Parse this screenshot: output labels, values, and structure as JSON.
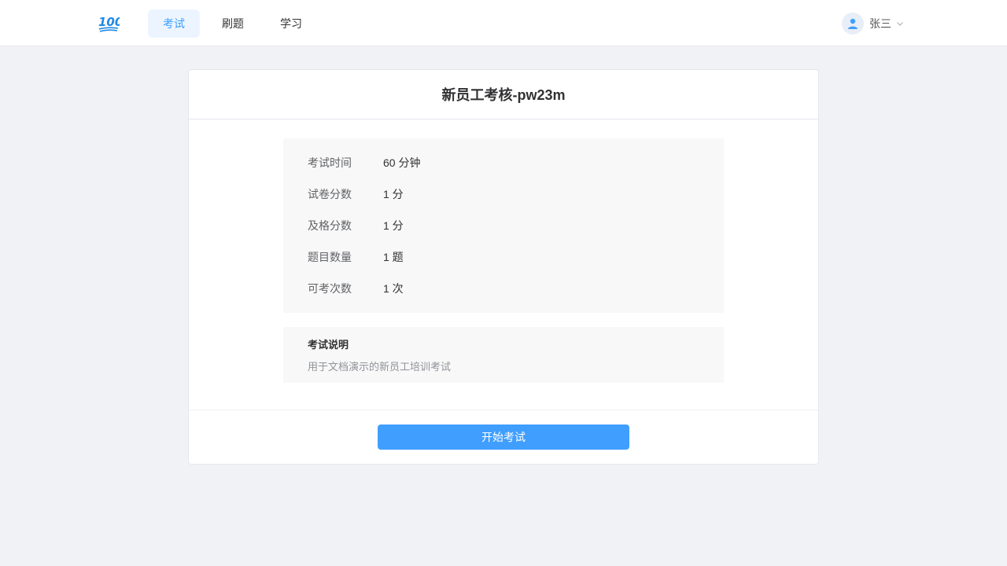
{
  "header": {
    "logo_icon": "hundred-points-logo",
    "nav": [
      {
        "label": "考试",
        "active": true
      },
      {
        "label": "刷题",
        "active": false
      },
      {
        "label": "学习",
        "active": false
      }
    ],
    "user": {
      "name": "张三",
      "avatar_icon": "user-icon",
      "dropdown_icon": "chevron-down-icon"
    }
  },
  "exam": {
    "title": "新员工考核-pw23m",
    "info": [
      {
        "label": "考试时间",
        "value": "60 分钟"
      },
      {
        "label": "试卷分数",
        "value": "1 分"
      },
      {
        "label": "及格分数",
        "value": "1 分"
      },
      {
        "label": "题目数量",
        "value": "1 题"
      },
      {
        "label": "可考次数",
        "value": "1 次"
      }
    ],
    "description_title": "考试说明",
    "description_text": "用于文档演示的新员工培训考试",
    "start_button": "开始考试"
  },
  "colors": {
    "accent": "#409eff",
    "active_nav_bg": "#ecf5ff",
    "page_bg": "#f0f2f5",
    "panel_bg": "#f8f8f8"
  }
}
